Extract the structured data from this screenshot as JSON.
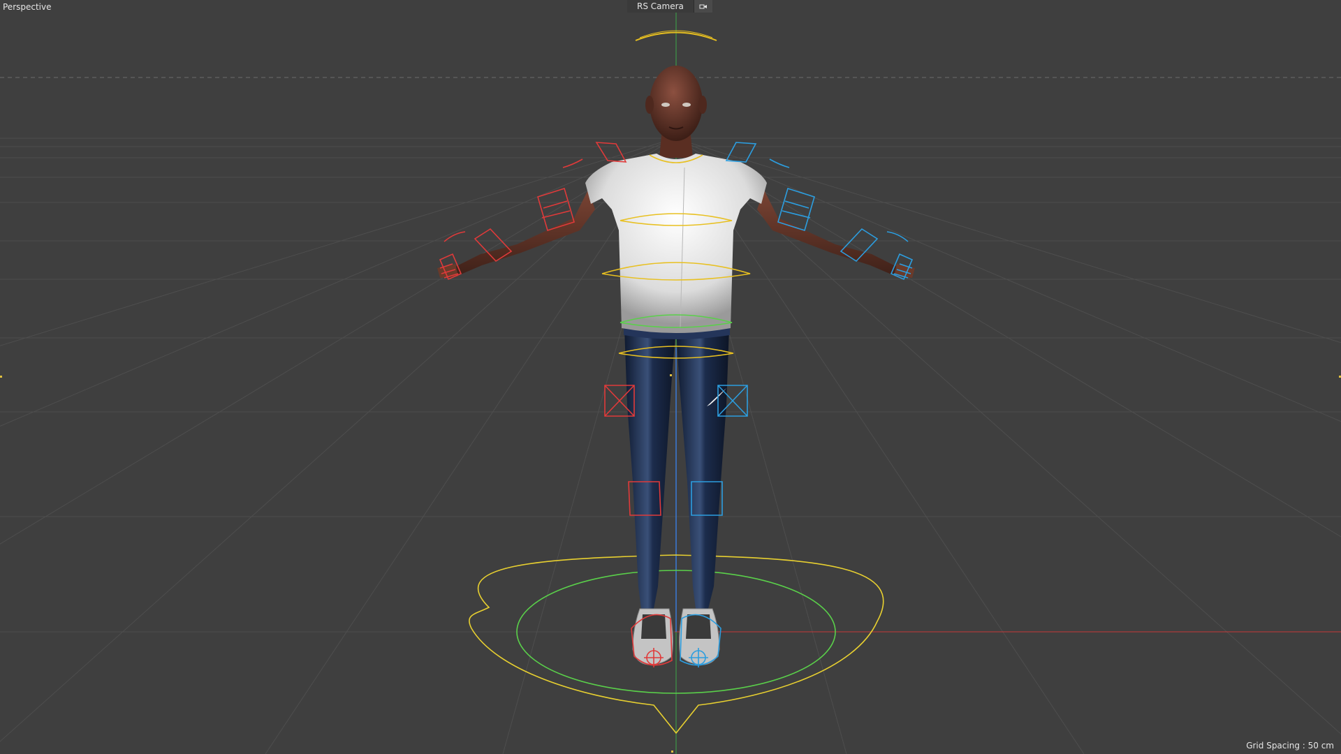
{
  "viewport": {
    "view_name": "Perspective",
    "camera_name": "RS Camera",
    "grid_spacing_text": "Grid Spacing : 50 cm"
  },
  "icons": {
    "camera_toggle": "camera-options-icon"
  },
  "colors": {
    "background": "#3f3f3f",
    "grid_line": "#505050",
    "horizon_dash": "#6a6a6a",
    "x_axis": "#c63a3a",
    "y_axis": "#3ea84a",
    "z_axis": "#3a7ad8",
    "left_controls": "#e03a3a",
    "right_controls": "#2c9ee0",
    "spine_controls": "#e8c020",
    "hip_control": "#5ad04a",
    "root_control": "#e8d030",
    "skin": "#6a3a2a",
    "shirt": "#e8e8e8",
    "pants": "#1d2c4a",
    "shoes": "#bdbdbd"
  }
}
